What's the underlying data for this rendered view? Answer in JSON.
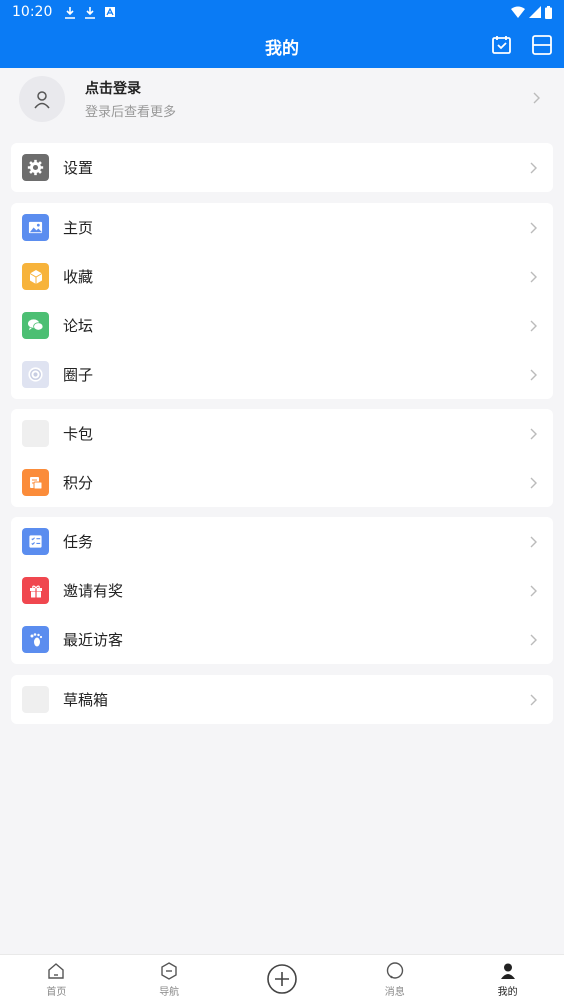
{
  "status_bar": {
    "time": "10:20"
  },
  "header": {
    "title": "我的"
  },
  "profile": {
    "title": "点击登录",
    "subtitle": "登录后查看更多"
  },
  "groups": [
    [
      {
        "label": "设置",
        "icon": "gear-icon",
        "color": "#6d6d6d"
      }
    ],
    [
      {
        "label": "主页",
        "icon": "image-icon",
        "color": "#5b8def"
      },
      {
        "label": "收藏",
        "icon": "box-icon",
        "color": "#f7b33b"
      },
      {
        "label": "论坛",
        "icon": "chat-icon",
        "color": "#4cbf73"
      },
      {
        "label": "圈子",
        "icon": "circle-icon",
        "color": "#dfe3f1"
      }
    ],
    [
      {
        "label": "卡包",
        "icon": "card-icon",
        "color": "#efefef"
      },
      {
        "label": "积分",
        "icon": "points-icon",
        "color": "#fb8c3a"
      }
    ],
    [
      {
        "label": "任务",
        "icon": "task-icon",
        "color": "#5b8def"
      },
      {
        "label": "邀请有奖",
        "icon": "gift-icon",
        "color": "#f0474f"
      },
      {
        "label": "最近访客",
        "icon": "footprint-icon",
        "color": "#5b8def"
      }
    ],
    [
      {
        "label": "草稿箱",
        "icon": "draft-icon",
        "color": "#efefef"
      }
    ]
  ],
  "bottom_nav": [
    {
      "label": "首页",
      "icon": "home-icon"
    },
    {
      "label": "导航",
      "icon": "navigation-icon"
    },
    {
      "label": "",
      "icon": "add-icon"
    },
    {
      "label": "消息",
      "icon": "message-icon"
    },
    {
      "label": "我的",
      "icon": "profile-icon",
      "active": true
    }
  ],
  "colors": {
    "primary": "#0a7bf5",
    "background": "#f5f5f7"
  }
}
